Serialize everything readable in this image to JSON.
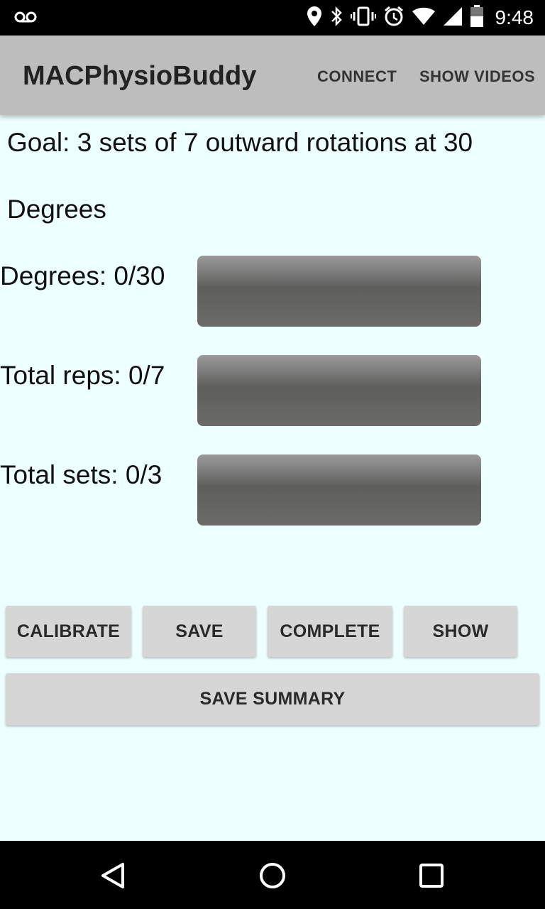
{
  "status_bar": {
    "time": "9:48",
    "icons": [
      "voicemail-icon",
      "location-icon",
      "bluetooth-icon",
      "vibrate-icon",
      "alarm-icon",
      "wifi-icon",
      "signal-icon",
      "battery-icon"
    ]
  },
  "app_bar": {
    "title": "MACPhysioBuddy",
    "actions": [
      "CONNECT",
      "SHOW VIDEOS"
    ]
  },
  "goal": {
    "line1": "Goal: 3 sets of 7 outward rotations at 30",
    "line2": "Degrees"
  },
  "stats": [
    {
      "label": "Degrees: 0/30",
      "progress": 0
    },
    {
      "label": "Total reps: 0/7",
      "progress": 0
    },
    {
      "label": "Total sets: 0/3",
      "progress": 0
    }
  ],
  "buttons": {
    "calibrate": "CALIBRATE",
    "save": "SAVE",
    "complete": "COMPLETE",
    "show": "SHOW",
    "save_summary": "SAVE SUMMARY"
  },
  "colors": {
    "background": "#edffff",
    "app_bar": "#bdbdbd",
    "button": "#d6d6d6",
    "progress_bar": "#5e5f5d"
  }
}
